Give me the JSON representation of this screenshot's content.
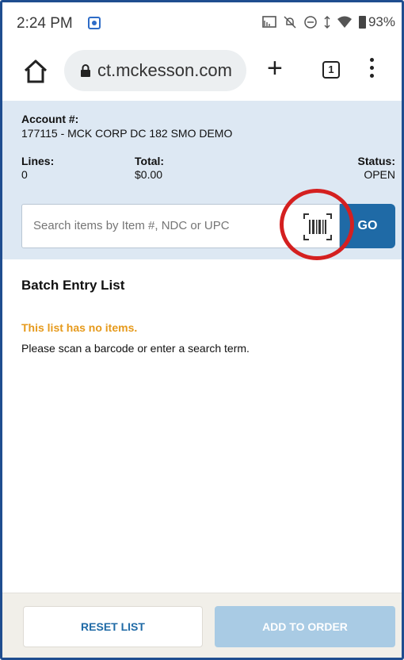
{
  "status_bar": {
    "time": "2:24 PM",
    "app_icon": "quick-app-icon",
    "icons": [
      "cast-icon",
      "bell-off-icon",
      "dnd-icon",
      "signal-icon",
      "wifi-icon",
      "battery-icon"
    ],
    "battery": "93%"
  },
  "browser": {
    "url": "ct.mckesson.com",
    "tab_count": "1"
  },
  "account": {
    "account_label": "Account #:",
    "account_value": "177115 - MCK CORP DC 182 SMO DEMO",
    "lines_label": "Lines:",
    "lines_value": "0",
    "total_label": "Total:",
    "total_value": "$0.00",
    "status_label": "Status:",
    "status_value": "OPEN"
  },
  "search": {
    "placeholder": "Search items by Item #, NDC or UPC",
    "go_label": "GO"
  },
  "list": {
    "title": "Batch Entry List",
    "empty_message": "This list has no items.",
    "help_message": "Please scan a barcode or enter a search term."
  },
  "footer": {
    "reset_label": "RESET LIST",
    "add_label": "ADD TO ORDER"
  },
  "colors": {
    "primary": "#1f6aa6",
    "panel_bg": "#dde8f3",
    "warning": "#e69a1c",
    "highlight_ring": "#d42020",
    "disabled_button": "#a9cbe4"
  }
}
